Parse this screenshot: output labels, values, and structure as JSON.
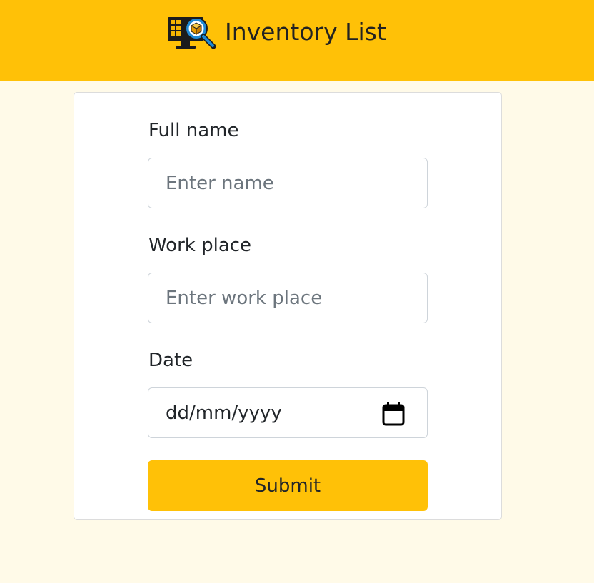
{
  "header": {
    "title": "Inventory List",
    "logo_icon": "inventory-search-icon",
    "background_color": "#ffc107"
  },
  "form": {
    "full_name": {
      "label": "Full name",
      "placeholder": "Enter name",
      "value": ""
    },
    "work_place": {
      "label": "Work place",
      "placeholder": "Enter work place",
      "value": ""
    },
    "date": {
      "label": "Date",
      "value": "dd/mm/yyyy",
      "icon": "calendar-icon"
    },
    "submit_label": "Submit",
    "submit_color": "#ffc107"
  },
  "page": {
    "background_color": "#fffae8"
  }
}
